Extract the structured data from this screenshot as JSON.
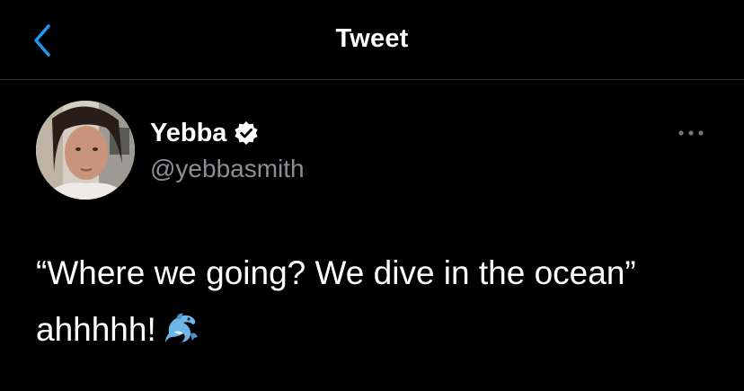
{
  "header": {
    "title": "Tweet",
    "back_icon": "chevron-left-icon"
  },
  "author": {
    "display_name": "Yebba",
    "handle": "@yebbasmith",
    "verified": true,
    "verified_icon": "verified-badge-icon",
    "avatar_icon": "avatar"
  },
  "tweet": {
    "text": "“Where we going? We dive in the ocean” ahhhhh!",
    "emoji": "dolphin-icon"
  },
  "menu": {
    "more_icon": "more-options-icon"
  },
  "colors": {
    "background": "#000000",
    "accent": "#1d9bf0",
    "secondary_text": "#8b8f94",
    "divider": "#2f3336"
  }
}
